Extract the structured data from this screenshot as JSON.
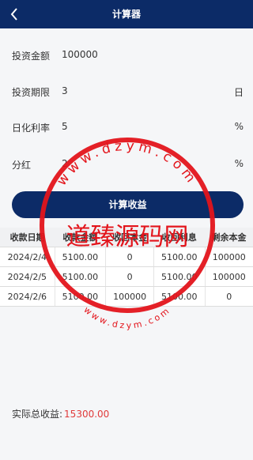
{
  "navbar": {
    "title": "计算器",
    "back_icon": "chevron-left-icon"
  },
  "form": {
    "fields": [
      {
        "label": "投资金额",
        "value": "100000",
        "unit": ""
      },
      {
        "label": "投资期限",
        "value": "3",
        "unit": "日"
      },
      {
        "label": "日化利率",
        "value": "5",
        "unit": "%"
      },
      {
        "label": "分红",
        "value": "2",
        "unit": "%"
      }
    ]
  },
  "calculate_button": "计算收益",
  "table": {
    "headers": [
      "收款日期",
      "收款金额",
      "收回本金",
      "收回利息",
      "剩余本金"
    ],
    "rows": [
      [
        "2024/2/4",
        "5100.00",
        "0",
        "5100.00",
        "100000"
      ],
      [
        "2024/2/5",
        "5100.00",
        "0",
        "5100.00",
        "100000"
      ],
      [
        "2024/2/6",
        "5100.00",
        "100000",
        "5100.00",
        "0"
      ]
    ]
  },
  "total": {
    "label": "实际总收益:",
    "amount": "15300.00"
  },
  "watermark": {
    "text": "道臻源码网",
    "url_top": "www.dzym.com",
    "url_bottom": "www.dzym.com",
    "color": "#e3141b"
  },
  "colors": {
    "primary": "#0c2b67",
    "accent_red": "#e03a3a"
  }
}
